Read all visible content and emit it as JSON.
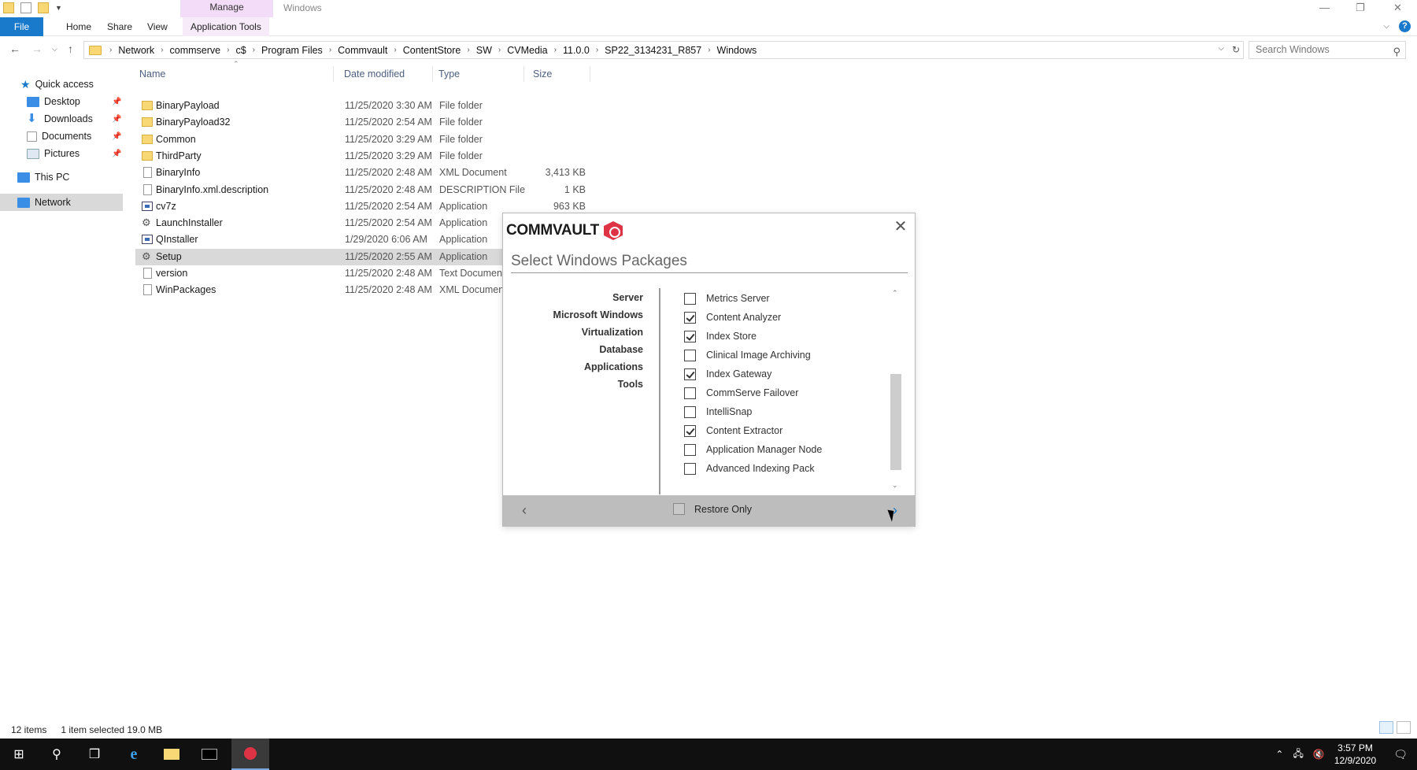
{
  "titlebar": {
    "manage_tab": "Manage",
    "window_title": "Windows"
  },
  "ribbon": {
    "tabs": [
      "File",
      "Home",
      "Share",
      "View",
      "Application Tools"
    ]
  },
  "address": {
    "crumbs": [
      "Network",
      "commserve",
      "c$",
      "Program Files",
      "Commvault",
      "ContentStore",
      "SW",
      "CVMedia",
      "11.0.0",
      "SP22_3134231_R857",
      "Windows"
    ],
    "search_placeholder": "Search Windows"
  },
  "navpane": {
    "quick_access": "Quick access",
    "items": [
      "Desktop",
      "Downloads",
      "Documents",
      "Pictures"
    ],
    "this_pc": "This PC",
    "network": "Network"
  },
  "columns": {
    "name": "Name",
    "date": "Date modified",
    "type": "Type",
    "size": "Size"
  },
  "files": [
    {
      "name": "BinaryPayload",
      "date": "11/25/2020 3:30 AM",
      "type": "File folder",
      "size": "",
      "icon": "folder-icon"
    },
    {
      "name": "BinaryPayload32",
      "date": "11/25/2020 2:54 AM",
      "type": "File folder",
      "size": "",
      "icon": "folder-icon"
    },
    {
      "name": "Common",
      "date": "11/25/2020 3:29 AM",
      "type": "File folder",
      "size": "",
      "icon": "folder-icon"
    },
    {
      "name": "ThirdParty",
      "date": "11/25/2020 3:29 AM",
      "type": "File folder",
      "size": "",
      "icon": "folder-icon"
    },
    {
      "name": "BinaryInfo",
      "date": "11/25/2020 2:48 AM",
      "type": "XML Document",
      "size": "3,413 KB",
      "icon": "xml-document-icon"
    },
    {
      "name": "BinaryInfo.xml.description",
      "date": "11/25/2020 2:48 AM",
      "type": "DESCRIPTION File",
      "size": "1 KB",
      "icon": "document-icon"
    },
    {
      "name": "cv7z",
      "date": "11/25/2020 2:54 AM",
      "type": "Application",
      "size": "963 KB",
      "icon": "application-icon"
    },
    {
      "name": "LaunchInstaller",
      "date": "11/25/2020 2:54 AM",
      "type": "Application",
      "size": "",
      "icon": "installer-gear-icon"
    },
    {
      "name": "QInstaller",
      "date": "1/29/2020 6:06 AM",
      "type": "Application",
      "size": "",
      "icon": "application-icon"
    },
    {
      "name": "Setup",
      "date": "11/25/2020 2:55 AM",
      "type": "Application",
      "size": "",
      "icon": "installer-gear-icon"
    },
    {
      "name": "version",
      "date": "11/25/2020 2:48 AM",
      "type": "Text Document",
      "size": "",
      "icon": "text-document-icon"
    },
    {
      "name": "WinPackages",
      "date": "11/25/2020 2:48 AM",
      "type": "XML Document",
      "size": "",
      "icon": "xml-document-icon"
    }
  ],
  "status": {
    "count": "12 items",
    "selection": "1 item selected  19.0 MB"
  },
  "dialog": {
    "brand": "COMMVAULT",
    "title": "Select Windows Packages",
    "categories": [
      "Server",
      "Microsoft Windows",
      "Virtualization",
      "Database",
      "Applications",
      "Tools"
    ],
    "packages": [
      {
        "label": "Metrics Server",
        "checked": false
      },
      {
        "label": "Content Analyzer",
        "checked": true
      },
      {
        "label": "Index Store",
        "checked": true
      },
      {
        "label": "Clinical Image Archiving",
        "checked": false
      },
      {
        "label": "Index Gateway",
        "checked": true
      },
      {
        "label": "CommServe Failover",
        "checked": false
      },
      {
        "label": "IntelliSnap",
        "checked": false
      },
      {
        "label": "Content Extractor",
        "checked": true
      },
      {
        "label": "Application Manager Node",
        "checked": false
      },
      {
        "label": "Advanced Indexing Pack",
        "checked": false
      }
    ],
    "restore_only": "Restore Only",
    "restore_only_checked": false
  },
  "taskbar": {
    "time": "3:57 PM",
    "date": "12/9/2020"
  },
  "colors": {
    "accent": "#1979ca",
    "selection": "#d9d9d9",
    "brand_red": "#dd3344",
    "manage_tab": "#f3dcf7"
  }
}
